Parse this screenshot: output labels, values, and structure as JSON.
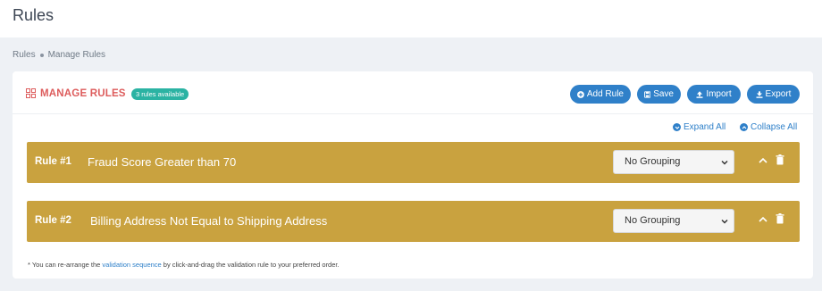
{
  "page": {
    "title": "Rules"
  },
  "breadcrumb": {
    "items": [
      "Rules",
      "Manage Rules"
    ]
  },
  "card": {
    "title": "MANAGE RULES",
    "badge": "3 rules available",
    "buttons": {
      "add": "Add Rule",
      "save": "Save",
      "import": "Import",
      "export": "Export"
    },
    "expand_all": "Expand All",
    "collapse_all": "Collapse All"
  },
  "rules": [
    {
      "number": "Rule #1",
      "name": "Fraud Score Greater than 70",
      "grouping": "No Grouping"
    },
    {
      "number": "Rule #2",
      "name": "Billing Address Not Equal to Shipping Address",
      "grouping": "No Grouping"
    }
  ],
  "footnote": {
    "before": "* You can re-arrange the ",
    "link": "validation sequence",
    "after": " by click-and-drag the validation rule to your preferred order."
  },
  "colors": {
    "accent": "#2f80c9",
    "title_red": "#dd5c5c",
    "badge_teal": "#2bb3a3",
    "rule_gold": "#c9a23f",
    "background": "#eef1f5"
  },
  "icons": {
    "title": "grid-icon",
    "add": "plus-circle-icon",
    "save": "floppy-icon",
    "import": "upload-icon",
    "export": "download-icon",
    "expand": "chevron-down-circle-icon",
    "collapse": "chevron-up-circle-icon",
    "rule_collapse": "chevron-up-icon",
    "rule_delete": "trash-icon",
    "select_caret": "chevron-down-icon"
  }
}
